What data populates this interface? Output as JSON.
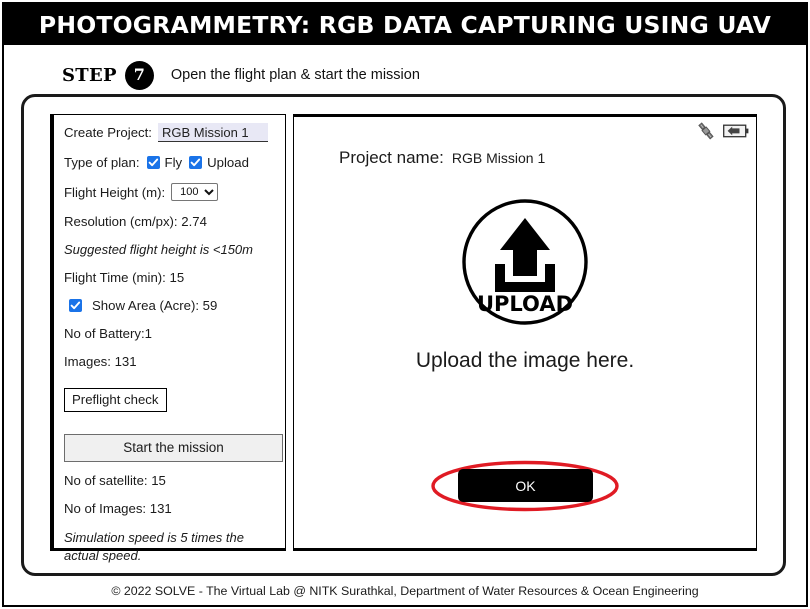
{
  "header": {
    "title": "PHOTOGRAMMETRY: RGB DATA CAPTURING USING UAV"
  },
  "step": {
    "word": "STEP",
    "number": "7",
    "description": "Open the flight plan & start the mission"
  },
  "left_panel": {
    "create_project_label": "Create Project:",
    "project_name_value": "RGB Mission 1",
    "project_name_placeholder": "Project name",
    "type_of_plan_label": "Type of plan:",
    "fly_label": "Fly",
    "fly_checked": true,
    "upload_label": "Upload",
    "upload_checked": true,
    "flight_height_label": "Flight Height (m):",
    "flight_height_value": "100",
    "flight_height_options": [
      "100"
    ],
    "resolution_label": "Resolution (cm/px): 2.74",
    "suggested_height_note": "Suggested flight height is <150m",
    "flight_time_label": "Flight Time (min): 15",
    "show_area_label": "Show Area (Acre): 59",
    "show_area_checked": true,
    "no_of_battery_label": "No of Battery:1",
    "images_label": "Images: 131",
    "preflight_button": "Preflight check",
    "start_mission_button": "Start the mission",
    "no_of_satellite_label": "No of satellite: 15",
    "no_of_images_label": "No of Images: 131",
    "simulation_note": "Simulation speed is 5 times the actual speed."
  },
  "right_panel": {
    "project_name_label": "Project name:",
    "project_name_value": "RGB Mission 1",
    "upload_icon_text": "UPLOAD",
    "upload_caption": "Upload the image here.",
    "ok_button": "OK",
    "satellite_icon": "satellite-icon",
    "battery_icon": "battery-icon",
    "highlight_color": "#e01b24"
  },
  "footer": {
    "text": "© 2022 SOLVE - The Virtual Lab @ NITK Surathkal, Department of Water Resources & Ocean Engineering"
  }
}
